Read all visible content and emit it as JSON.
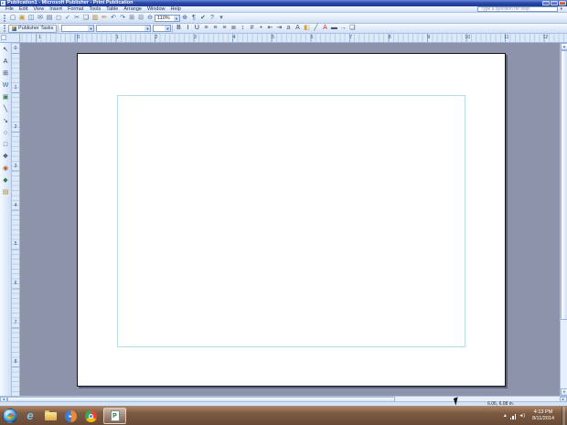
{
  "colors": {
    "titlebar_blue": "#2a4aa8",
    "office_toolbar_blue": "#d0dff5",
    "workspace_gray": "#8d93a9",
    "margin_guide_cyan": "#b5dde8",
    "page_white": "#ffffff",
    "taskbar_brown": "#7c5a42",
    "close_button_red": "#c63d1e"
  },
  "titlebar": {
    "title": "Publication1 - Microsoft Publisher - Print Publication",
    "app_icon_letter": "P"
  },
  "menubar": {
    "items": [
      "File",
      "Edit",
      "View",
      "Insert",
      "Format",
      "Tools",
      "Table",
      "Arrange",
      "Window",
      "Help"
    ],
    "help_placeholder": "Type a question for help"
  },
  "standard_toolbar": {
    "zoom_value": "110%",
    "icons": [
      {
        "name": "new-button",
        "glyph": "▢",
        "color": "#3f63a8"
      },
      {
        "name": "open-button",
        "glyph": "▣",
        "color": "#c99a3a"
      },
      {
        "name": "save-button",
        "glyph": "◫",
        "color": "#3f63a8"
      },
      {
        "name": "email-button",
        "glyph": "✉",
        "color": "#55688a"
      },
      {
        "name": "print-button",
        "glyph": "▤",
        "color": "#55688a"
      },
      {
        "name": "print-preview-button",
        "glyph": "◻",
        "color": "#55688a"
      },
      {
        "name": "spelling-button",
        "glyph": "✓",
        "color": "#2f62a8"
      },
      {
        "name": "cut-button",
        "glyph": "✂",
        "color": "#55688a"
      },
      {
        "name": "copy-button",
        "glyph": "❏",
        "color": "#55688a"
      },
      {
        "name": "paste-button",
        "glyph": "▥",
        "color": "#b08030"
      },
      {
        "name": "format-painter-button",
        "glyph": "✏",
        "color": "#b08030"
      },
      {
        "name": "undo-button",
        "glyph": "↶",
        "color": "#2f62a8"
      },
      {
        "name": "redo-button",
        "glyph": "↷",
        "color": "#2f62a8"
      },
      {
        "name": "bring-to-front-button",
        "glyph": "⊞",
        "color": "#55688a"
      },
      {
        "name": "send-to-back-button",
        "glyph": "⊟",
        "color": "#55688a"
      },
      {
        "name": "zoom-out-button",
        "glyph": "⊖",
        "color": "#2f62a8"
      }
    ],
    "icons_after": [
      {
        "name": "zoom-in-button",
        "glyph": "⊕",
        "color": "#2f62a8"
      },
      {
        "name": "special-characters-button",
        "glyph": "¶",
        "color": "#2f62a8"
      },
      {
        "name": "design-checker-button",
        "glyph": "✔",
        "color": "#2e7d46"
      },
      {
        "name": "help-button",
        "glyph": "?",
        "color": "#2f62a8"
      },
      {
        "name": "toolbar-options-button",
        "glyph": "▾",
        "color": "#55688a"
      }
    ]
  },
  "formatting_toolbar": {
    "tasks_label": "Publisher Tasks",
    "style_combo_value": "",
    "font_combo_value": "",
    "size_combo_value": "",
    "icons": [
      {
        "name": "bold-button",
        "glyph": "B",
        "color": "#17294e"
      },
      {
        "name": "italic-button",
        "glyph": "I",
        "color": "#17294e"
      },
      {
        "name": "underline-button",
        "glyph": "U",
        "color": "#17294e"
      },
      {
        "name": "align-left-button",
        "glyph": "≡",
        "color": "#44546e"
      },
      {
        "name": "align-center-button",
        "glyph": "≡",
        "color": "#44546e"
      },
      {
        "name": "align-right-button",
        "glyph": "≡",
        "color": "#44546e"
      },
      {
        "name": "justify-button",
        "glyph": "≣",
        "color": "#44546e"
      },
      {
        "name": "line-spacing-button",
        "glyph": "↕",
        "color": "#44546e"
      },
      {
        "name": "numbering-button",
        "glyph": "#",
        "color": "#44546e"
      },
      {
        "name": "bullets-button",
        "glyph": "•",
        "color": "#44546e"
      },
      {
        "name": "decrease-indent-button",
        "glyph": "⇤",
        "color": "#44546e"
      },
      {
        "name": "increase-indent-button",
        "glyph": "⇥",
        "color": "#44546e"
      },
      {
        "name": "decrease-font-button",
        "glyph": "a",
        "color": "#44546e"
      },
      {
        "name": "increase-font-button",
        "glyph": "A",
        "color": "#44546e"
      },
      {
        "name": "fill-color-button",
        "glyph": "◧",
        "color": "#d9a520"
      },
      {
        "name": "line-color-button",
        "glyph": "╱",
        "color": "#2e7d46"
      },
      {
        "name": "font-color-button",
        "glyph": "A",
        "color": "#c0392b"
      },
      {
        "name": "line-style-button",
        "glyph": "▬",
        "color": "#44546e"
      },
      {
        "name": "arrow-style-button",
        "glyph": "→",
        "color": "#44546e"
      },
      {
        "name": "shadow-style-button",
        "glyph": "❏",
        "color": "#44546e"
      }
    ]
  },
  "object_toolbar": {
    "icons": [
      {
        "name": "select-objects-tool",
        "glyph": "↖",
        "color": "#2c3e66"
      },
      {
        "name": "text-box-tool",
        "glyph": "A",
        "color": "#2c3e66"
      },
      {
        "name": "insert-table-tool",
        "glyph": "⊞",
        "color": "#2c3e66"
      },
      {
        "name": "insert-wordart-tool",
        "glyph": "W",
        "color": "#2f62a8"
      },
      {
        "name": "picture-frame-tool",
        "glyph": "▣",
        "color": "#3a7d4e"
      },
      {
        "name": "line-tool",
        "glyph": "╲",
        "color": "#2c3e66"
      },
      {
        "name": "arrow-tool",
        "glyph": "↘",
        "color": "#2c3e66"
      },
      {
        "name": "oval-tool",
        "glyph": "○",
        "color": "#2c3e66"
      },
      {
        "name": "rectangle-tool",
        "glyph": "□",
        "color": "#2c3e66"
      },
      {
        "name": "autoshapes-tool",
        "glyph": "❖",
        "color": "#2c3e66"
      },
      {
        "name": "hot-spot-tool",
        "glyph": "◉",
        "color": "#b05a2a"
      },
      {
        "name": "design-gallery-object-tool",
        "glyph": "◆",
        "color": "#2e7d46"
      },
      {
        "name": "content-library-tool",
        "glyph": "▤",
        "color": "#b08030"
      }
    ]
  },
  "rulers": {
    "horizontal_labels": [
      "1",
      "0",
      "1",
      "2",
      "3",
      "4",
      "5",
      "6",
      "7",
      "8",
      "9",
      "10",
      "11",
      "12"
    ],
    "vertical_labels": [
      "0",
      "1",
      "2",
      "3",
      "4",
      "5",
      "6",
      "7",
      "8"
    ]
  },
  "statusbar": {
    "object_position": "6.06, 6.08 in."
  },
  "taskbar": {
    "buttons": [
      "start",
      "internet-explorer",
      "windows-explorer",
      "media-player",
      "chrome",
      "publisher-active-window"
    ],
    "tray_icons": [
      "show-hidden-icons",
      "network",
      "volume"
    ],
    "clock_time": "4:13 PM",
    "clock_date": "8/11/2014"
  }
}
